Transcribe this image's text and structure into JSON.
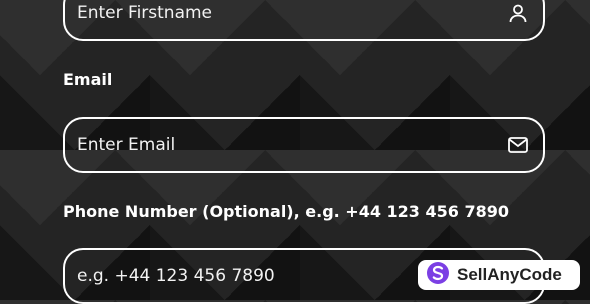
{
  "form": {
    "firstname": {
      "placeholder": "Enter Firstname",
      "icon": "user-icon"
    },
    "email": {
      "label": "Email",
      "placeholder": "Enter Email",
      "icon": "mail-icon"
    },
    "phone": {
      "label": "Phone Number (Optional), e.g. +44 123 456 7890",
      "placeholder": "e.g. +44 123 456 7890"
    }
  },
  "watermark": {
    "text": "SellAnyCode",
    "accent": "#7b3fe4"
  }
}
